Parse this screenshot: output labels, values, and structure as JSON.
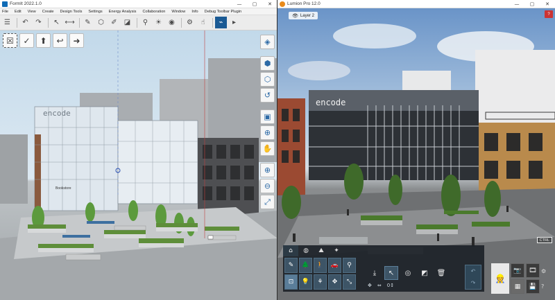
{
  "formit": {
    "title": "FormIt 2022.1.0",
    "window_controls": [
      "—",
      "▢",
      "✕"
    ],
    "menu": [
      "File",
      "Edit",
      "View",
      "Create",
      "Design Tools",
      "Settings",
      "Energy Analysis",
      "Collaboration",
      "Window",
      "Info",
      "Debug Toolbar Plugin"
    ],
    "toolbar_icons": [
      "panel-toggle-icon",
      "undo-icon",
      "redo-icon",
      "select-icon",
      "measure-icon",
      "edit-icon",
      "paint-icon",
      "component-icon",
      "cube-icon",
      "move-icon",
      "rotate-icon",
      "marker-icon",
      "sun-icon",
      "camera-icon",
      "settings-icon",
      "hand-icon",
      "dynamo-icon"
    ],
    "mini_toolbar": [
      "☒",
      "✓",
      "⬆",
      "↩",
      "➜"
    ],
    "viewport_labels": {
      "building_sign": "encode",
      "storefront_sign": "Bookstore"
    }
  },
  "lumion": {
    "title": "Lumion Pro 12.0",
    "window_controls": [
      "—",
      "▢",
      "✕"
    ],
    "layer_label": "Layer 2",
    "help_badge": "?",
    "ctrl_badge": "CTRL",
    "building_sign": "encode",
    "tabs": [
      "⌂",
      "◍",
      "⛰",
      "✦"
    ],
    "object_grid": [
      "✎",
      "🌲",
      "🚶",
      "🚗",
      "⚲",
      "⊡",
      "💡",
      "⚘",
      "✥",
      "⤡"
    ],
    "tools": [
      "⤓",
      "↖",
      "◎",
      "◩",
      "🗑"
    ],
    "tools_row2": [
      "✥",
      "⇔",
      "0↕"
    ],
    "side": [
      "↶",
      "↷"
    ],
    "right_panel": {
      "big": "👷",
      "grid": [
        "📷",
        "🎞",
        "▦",
        "💾"
      ],
      "col": [
        "⚙",
        "?"
      ]
    }
  }
}
